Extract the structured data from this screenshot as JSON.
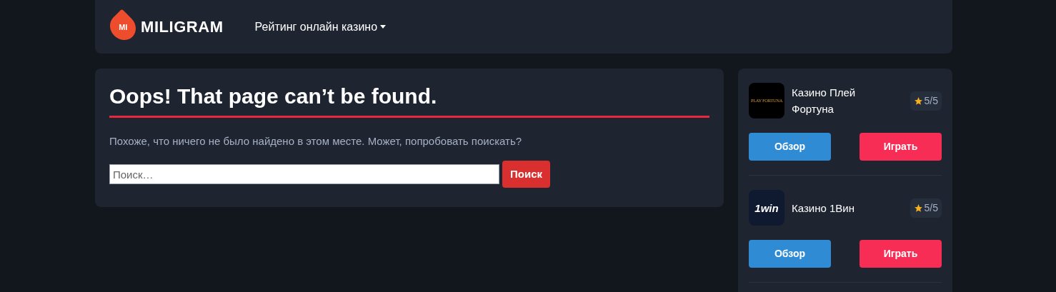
{
  "header": {
    "logo_mark": "MI",
    "brand": "MILIGRAM",
    "nav": [
      {
        "label": "Рейтинг онлайн казино",
        "has_dropdown": true
      }
    ]
  },
  "main": {
    "title": "Oops! That page can’t be found.",
    "message": "Похоже, что ничего не было найдено в этом месте. Может, попробовать поискать?",
    "search": {
      "placeholder": "Поиск…",
      "button": "Поиск"
    }
  },
  "sidebar": {
    "casinos": [
      {
        "name": "Казино Плей Фортуна",
        "logo": "PLAY FORTUNA",
        "kind": "fortuna",
        "rating": "5/5",
        "review": "Обзор",
        "play": "Играть"
      },
      {
        "name": "Казино 1Вин",
        "logo": "1win",
        "kind": "onewin",
        "rating": "5/5",
        "review": "Обзор",
        "play": "Играть"
      }
    ]
  }
}
